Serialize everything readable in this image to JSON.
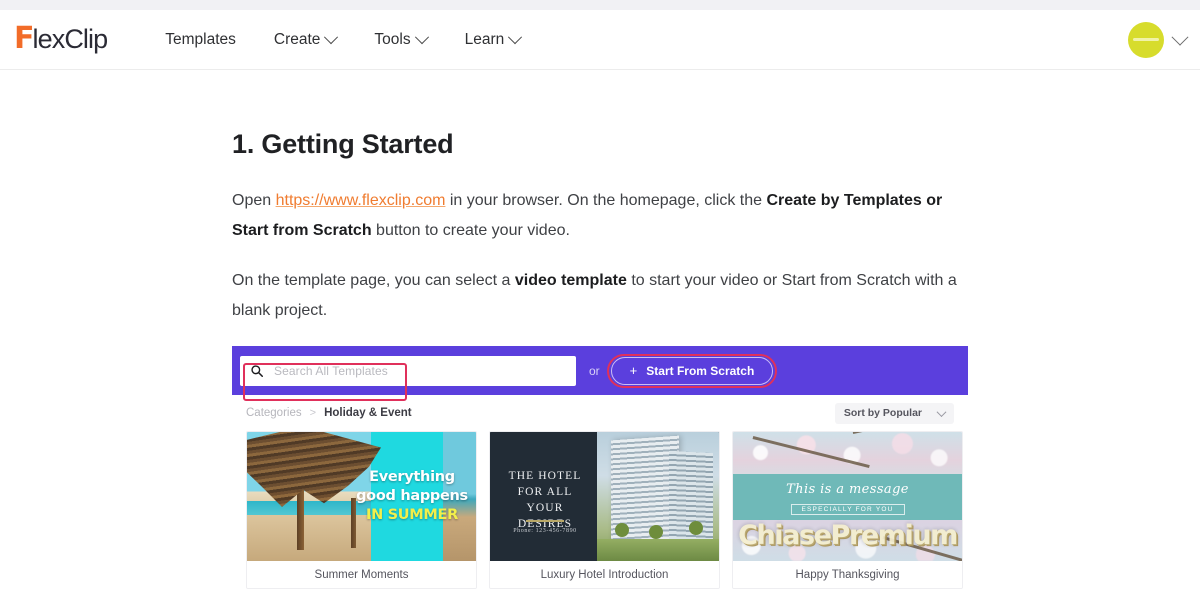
{
  "header": {
    "logo": {
      "mark": "F",
      "text": "lexClip",
      "full": "FlexClip"
    },
    "nav": [
      {
        "label": "Templates",
        "has_chevron": false
      },
      {
        "label": "Create",
        "has_chevron": true
      },
      {
        "label": "Tools",
        "has_chevron": true
      },
      {
        "label": "Learn",
        "has_chevron": true
      }
    ],
    "avatar": {
      "icon": "user-avatar",
      "color": "#d7dc2c"
    },
    "account_chevron": "chevron-down-icon"
  },
  "article": {
    "title": "1. Getting Started",
    "paragraph1": {
      "pre": "Open ",
      "link": "https://www.flexclip.com",
      "mid": " in your browser. On the homepage, click the ",
      "bold": "Create by Templates or Start from Scratch",
      "post": " button to create your video."
    },
    "paragraph2": {
      "pre": "On the template page, you can select a ",
      "bold": "video template",
      "post": " to start your video or Start from Scratch with a blank project."
    }
  },
  "screenshot": {
    "searchbar": {
      "search_icon": "search-icon",
      "placeholder": "Search All Templates",
      "value": "",
      "or_label": "or",
      "scratch_button": {
        "plus": "+",
        "label": "Start From Scratch"
      },
      "bar_color": "#5b3fdd",
      "annotation_color": "#e0305b"
    },
    "breadcrumb": {
      "root": "Categories",
      "separator": ">",
      "current": "Holiday & Event"
    },
    "sort": {
      "label": "Sort by Popular",
      "chevron": "chevron-down-icon"
    },
    "cards": [
      {
        "name": "Summer Moments",
        "overlay_line1": "Everything",
        "overlay_line2": "good happens",
        "overlay_line3": "IN SUMMER",
        "accent": "#1fd9e0",
        "highlight_color": "#f2ef4b"
      },
      {
        "name": "Luxury Hotel Introduction",
        "overlay_line1": "THE HOTEL",
        "overlay_line2": "FOR ALL YOUR",
        "overlay_line3": "DESIRES",
        "phone": "Phone: 123-456-7890",
        "accent": "#222c36"
      },
      {
        "name": "Happy Thanksgiving",
        "overlay_line1": "This is a message",
        "overlay_line2": "ESPECIALLY FOR YOU",
        "watermark": "ChiasePremium",
        "accent": "#6fb9b8"
      }
    ]
  }
}
